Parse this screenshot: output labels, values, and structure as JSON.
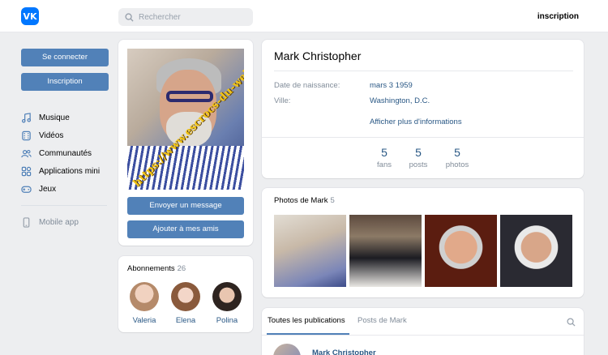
{
  "header": {
    "logo_text": "VK",
    "search_placeholder": "Rechercher",
    "signup_label": "inscription"
  },
  "left_nav": {
    "login_label": "Se connecter",
    "register_label": "Inscription",
    "items": [
      {
        "label": "Musique",
        "icon": "music-icon"
      },
      {
        "label": "Vidéos",
        "icon": "video-icon"
      },
      {
        "label": "Communautés",
        "icon": "communities-icon"
      },
      {
        "label": "Applications mini",
        "icon": "apps-icon"
      },
      {
        "label": "Jeux",
        "icon": "gamepad-icon"
      }
    ],
    "mobile_label": "Mobile app"
  },
  "profile": {
    "watermark": "https://www.escrocs-du-web.fr",
    "message_button": "Envoyer un message",
    "add_friend_button": "Ajouter à mes amis"
  },
  "subscriptions": {
    "title": "Abonnements",
    "count": "26",
    "people": [
      {
        "name": "Valeria"
      },
      {
        "name": "Elena"
      },
      {
        "name": "Polina"
      }
    ]
  },
  "info": {
    "name": "Mark Christopher",
    "birth_label": "Date de naissance:",
    "birth_value": "mars 3 1959",
    "city_label": "Ville:",
    "city_value": "Washington, D.C.",
    "more_link": "Afficher plus d'informations",
    "counters": [
      {
        "num": "5",
        "label": "fans"
      },
      {
        "num": "5",
        "label": "posts"
      },
      {
        "num": "5",
        "label": "photos"
      }
    ]
  },
  "photos": {
    "title": "Photos de Mark",
    "count": "5"
  },
  "feed": {
    "tab_all": "Toutes les publications",
    "tab_mark": "Posts de Mark",
    "post_author": "Mark Christopher"
  },
  "colors": {
    "accent": "#5181b8",
    "link": "#2a5885",
    "brand": "#0077ff",
    "background": "#edeef0"
  }
}
